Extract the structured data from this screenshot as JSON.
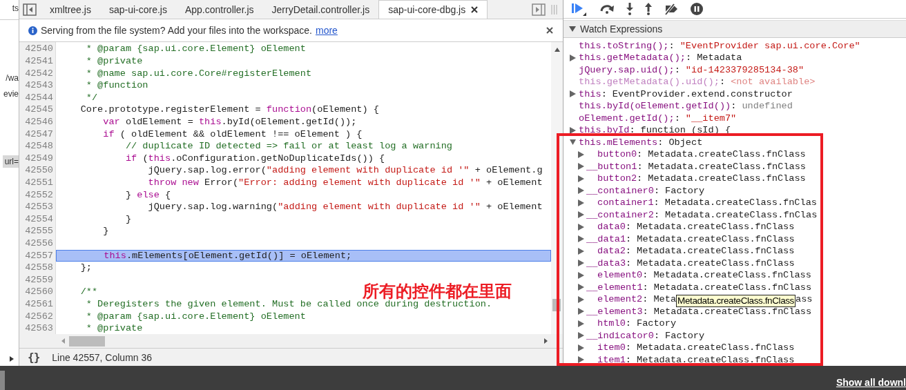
{
  "left_edge": {
    "texts": [
      "ts",
      "/wa",
      "evie",
      "url="
    ]
  },
  "editor": {
    "tabs": [
      {
        "label": "xmltree.js",
        "selected": false
      },
      {
        "label": "sap-ui-core.js",
        "selected": false
      },
      {
        "label": "App.controller.js",
        "selected": false
      },
      {
        "label": "JerryDetail.controller.js",
        "selected": false
      },
      {
        "label": "sap-ui-core-dbg.js",
        "selected": true,
        "closable": true
      }
    ],
    "infobar": {
      "message": "Serving from the file system? Add your files into the workspace.",
      "link": "more"
    },
    "lines": [
      {
        "number": "42540",
        "highlighted": false,
        "tokens": [
          {
            "kind": "comment",
            "text": "     * @param {sap.ui.core.Element} oElement"
          }
        ]
      },
      {
        "number": "42541",
        "highlighted": false,
        "tokens": [
          {
            "kind": "comment",
            "text": "     * @private"
          }
        ]
      },
      {
        "number": "42542",
        "highlighted": false,
        "tokens": [
          {
            "kind": "comment",
            "text": "     * @name sap.ui.core.Core#registerElement"
          }
        ]
      },
      {
        "number": "42543",
        "highlighted": false,
        "tokens": [
          {
            "kind": "comment",
            "text": "     * @function"
          }
        ]
      },
      {
        "number": "42544",
        "highlighted": false,
        "tokens": [
          {
            "kind": "comment",
            "text": "     */"
          }
        ]
      },
      {
        "number": "42545",
        "highlighted": false,
        "tokens": [
          {
            "kind": "plain",
            "text": "    Core.prototype.registerElement = "
          },
          {
            "kind": "keyword",
            "text": "function"
          },
          {
            "kind": "plain",
            "text": "(oElement) {"
          }
        ]
      },
      {
        "number": "42546",
        "highlighted": false,
        "tokens": [
          {
            "kind": "keyword",
            "text": "        var"
          },
          {
            "kind": "plain",
            "text": " oldElement = "
          },
          {
            "kind": "keyword",
            "text": "this"
          },
          {
            "kind": "plain",
            "text": ".byId(oElement.getId());"
          }
        ]
      },
      {
        "number": "42547",
        "highlighted": false,
        "tokens": [
          {
            "kind": "keyword",
            "text": "        if"
          },
          {
            "kind": "plain",
            "text": " ( oldElement && oldElement !== oElement ) {"
          }
        ]
      },
      {
        "number": "42548",
        "highlighted": false,
        "tokens": [
          {
            "kind": "comment",
            "text": "            // duplicate ID detected => fail or at least log a warning"
          }
        ]
      },
      {
        "number": "42549",
        "highlighted": false,
        "tokens": [
          {
            "kind": "keyword",
            "text": "            if"
          },
          {
            "kind": "plain",
            "text": " ("
          },
          {
            "kind": "keyword",
            "text": "this"
          },
          {
            "kind": "plain",
            "text": ".oConfiguration.getNoDuplicateIds()) {"
          }
        ]
      },
      {
        "number": "42550",
        "highlighted": false,
        "tokens": [
          {
            "kind": "plain",
            "text": "                jQuery.sap.log.error("
          },
          {
            "kind": "string",
            "text": "\"adding element with duplicate id '\""
          },
          {
            "kind": "plain",
            "text": " + oElement.g"
          }
        ]
      },
      {
        "number": "42551",
        "highlighted": false,
        "tokens": [
          {
            "kind": "keyword",
            "text": "                throw new"
          },
          {
            "kind": "plain",
            "text": " Error("
          },
          {
            "kind": "string",
            "text": "\"Error: adding element with duplicate id '\""
          },
          {
            "kind": "plain",
            "text": " + oElement"
          }
        ]
      },
      {
        "number": "42552",
        "highlighted": false,
        "tokens": [
          {
            "kind": "plain",
            "text": "            } "
          },
          {
            "kind": "keyword",
            "text": "else"
          },
          {
            "kind": "plain",
            "text": " {"
          }
        ]
      },
      {
        "number": "42553",
        "highlighted": false,
        "tokens": [
          {
            "kind": "plain",
            "text": "                jQuery.sap.log.warning("
          },
          {
            "kind": "string",
            "text": "\"adding element with duplicate id '\""
          },
          {
            "kind": "plain",
            "text": " + oElement"
          }
        ]
      },
      {
        "number": "42554",
        "highlighted": false,
        "tokens": [
          {
            "kind": "plain",
            "text": "            }"
          }
        ]
      },
      {
        "number": "42555",
        "highlighted": false,
        "tokens": [
          {
            "kind": "plain",
            "text": "        }"
          }
        ]
      },
      {
        "number": "42556",
        "highlighted": false
      },
      {
        "number": "42557",
        "highlighted": true,
        "tokens": [
          {
            "kind": "keyword",
            "text": "        this"
          },
          {
            "kind": "plain",
            "text": ".mElements[oElement.getId()] = oElement;"
          }
        ]
      },
      {
        "number": "42558",
        "highlighted": false,
        "tokens": [
          {
            "kind": "plain",
            "text": "    };"
          }
        ]
      },
      {
        "number": "42559",
        "highlighted": false
      },
      {
        "number": "42560",
        "highlighted": false,
        "tokens": [
          {
            "kind": "comment",
            "text": "    /**"
          }
        ]
      },
      {
        "number": "42561",
        "highlighted": false,
        "tokens": [
          {
            "kind": "comment",
            "text": "     * Deregisters the given element. Must be called once during destruction."
          }
        ]
      },
      {
        "number": "42562",
        "highlighted": false,
        "tokens": [
          {
            "kind": "comment",
            "text": "     * @param {sap.ui.core.Element} oElement"
          }
        ]
      },
      {
        "number": "42563",
        "highlighted": false,
        "tokens": [
          {
            "kind": "comment",
            "text": "     * @private"
          }
        ]
      }
    ],
    "pretty_print": "{}",
    "status": "Line 42557, Column 36"
  },
  "annotation": "所有的控件都在里面",
  "watch": {
    "title": "Watch Expressions",
    "expanded": true,
    "items": [
      {
        "expandable": false,
        "dimmed": false,
        "name": "this.toString();",
        "separator": ":",
        "value": "\"EventProvider sap.ui.core.Core\"",
        "kind": "string"
      },
      {
        "expandable": true,
        "expanded": false,
        "dimmed": false,
        "name": "this.getMetadata();",
        "separator": ":",
        "value": "Metadata",
        "kind": "object"
      },
      {
        "expandable": false,
        "dimmed": false,
        "name": "jQuery.sap.uid();",
        "separator": ":",
        "value": "\"id-1423379285134-38\"",
        "kind": "string"
      },
      {
        "expandable": false,
        "dimmed": true,
        "name": "this.getMetadata().uid();",
        "separator": ":",
        "value": "<not available>",
        "kind": "string"
      },
      {
        "expandable": true,
        "expanded": false,
        "dimmed": false,
        "name": "this",
        "separator": ":",
        "value": "EventProvider.extend.constructor",
        "kind": "object"
      },
      {
        "expandable": false,
        "dimmed": false,
        "name": "this.byId(oElement.getId())",
        "separator": ":",
        "value": "undefined",
        "kind": "undefined"
      },
      {
        "expandable": false,
        "dimmed": false,
        "name": "oElement.getId();",
        "separator": ":",
        "value": "\"__item7\"",
        "kind": "string"
      },
      {
        "expandable": true,
        "expanded": false,
        "dimmed": false,
        "name": "this.byId",
        "separator": ":",
        "value": "function (sId) {",
        "kind": "object"
      },
      {
        "expandable": true,
        "expanded": true,
        "dimmed": false,
        "name": "this.mElements",
        "separator": ":",
        "value": "Object",
        "kind": "object",
        "children": [
          {
            "kind": "public",
            "name": "button0",
            "separator": ":",
            "value": "Metadata.createClass.fnClass"
          },
          {
            "kind": "private",
            "name": "__button1",
            "separator": ":",
            "value": "Metadata.createClass.fnClass"
          },
          {
            "kind": "public",
            "name": "button2",
            "separator": ":",
            "value": "Metadata.createClass.fnClass"
          },
          {
            "kind": "private",
            "name": "__container0",
            "separator": ":",
            "value": "Factory"
          },
          {
            "kind": "public",
            "name": "container1",
            "separator": ":",
            "value": "Metadata.createClass.fnClas"
          },
          {
            "kind": "private",
            "name": "__container2",
            "separator": ":",
            "value": "Metadata.createClass.fnClas"
          },
          {
            "kind": "public",
            "name": "data0",
            "separator": ":",
            "value": "Metadata.createClass.fnClass"
          },
          {
            "kind": "private",
            "name": "__data1",
            "separator": ":",
            "value": "Metadata.createClass.fnClass"
          },
          {
            "kind": "public",
            "name": "data2",
            "separator": ":",
            "value": "Metadata.createClass.fnClass"
          },
          {
            "kind": "private",
            "name": "__data3",
            "separator": ":",
            "value": "Metadata.createClass.fnClass"
          },
          {
            "kind": "public",
            "name": "element0",
            "separator": ":",
            "value": "Metadata.createClass.fnClass"
          },
          {
            "kind": "private",
            "name": "__element1",
            "separator": ":",
            "value": "Metadata.createClass.fnClass"
          },
          {
            "kind": "public",
            "name": "element2",
            "separator": ":",
            "value": "Meta",
            "tooltip": "Metadata.createClass.fnClass",
            "value_tail": "ass"
          },
          {
            "kind": "private",
            "name": "__element3",
            "separator": ":",
            "value": "Metadata.createClass.fnClass"
          },
          {
            "kind": "public",
            "name": "html0",
            "separator": ":",
            "value": "Factory"
          },
          {
            "kind": "private",
            "name": "__indicator0",
            "separator": ":",
            "value": "Factory"
          },
          {
            "kind": "public",
            "name": "item0",
            "separator": ":",
            "value": "Metadata.createClass.fnClass"
          },
          {
            "kind": "public",
            "name": "item1",
            "separator": ":",
            "value": "Metadata.createClass.fnClass"
          }
        ]
      }
    ]
  },
  "downloads": {
    "link": "Show all downl"
  }
}
